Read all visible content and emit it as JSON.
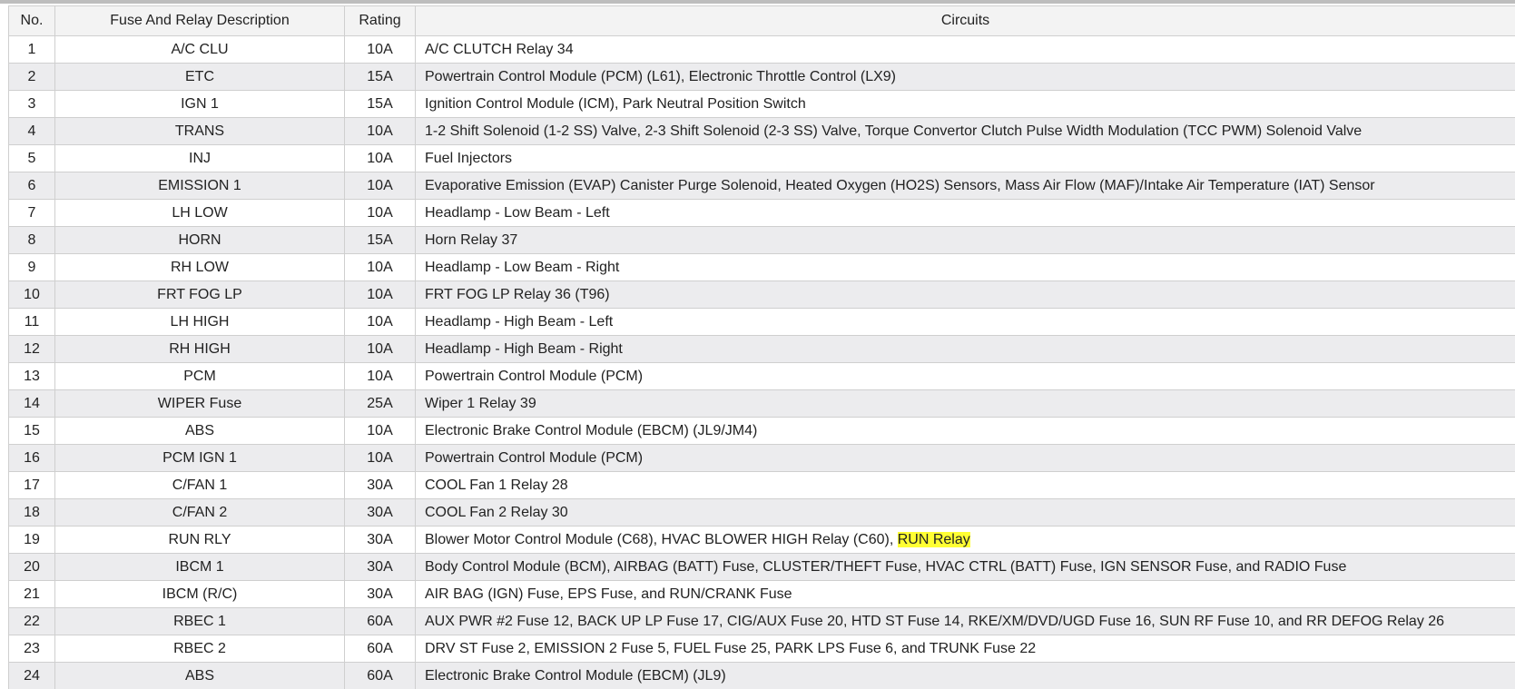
{
  "headers": [
    "No.",
    "Fuse And Relay Description",
    "Rating",
    "Circuits"
  ],
  "rows": [
    {
      "no": "1",
      "desc": "A/C CLU",
      "rating": "10A",
      "circuit": "A/C CLUTCH Relay 34"
    },
    {
      "no": "2",
      "desc": "ETC",
      "rating": "15A",
      "circuit": "Powertrain Control Module (PCM) (L61), Electronic Throttle Control (LX9)"
    },
    {
      "no": "3",
      "desc": "IGN 1",
      "rating": "15A",
      "circuit": "Ignition Control Module (ICM), Park Neutral Position Switch"
    },
    {
      "no": "4",
      "desc": "TRANS",
      "rating": "10A",
      "circuit": "1-2 Shift Solenoid (1-2 SS) Valve, 2-3 Shift Solenoid (2-3 SS) Valve, Torque Convertor Clutch Pulse Width Modulation (TCC PWM) Solenoid Valve"
    },
    {
      "no": "5",
      "desc": "INJ",
      "rating": "10A",
      "circuit": "Fuel Injectors"
    },
    {
      "no": "6",
      "desc": "EMISSION 1",
      "rating": "10A",
      "circuit": "Evaporative Emission (EVAP) Canister Purge Solenoid, Heated Oxygen (HO2S) Sensors, Mass Air Flow (MAF)/Intake Air Temperature (IAT) Sensor"
    },
    {
      "no": "7",
      "desc": "LH LOW",
      "rating": "10A",
      "circuit": "Headlamp - Low Beam - Left"
    },
    {
      "no": "8",
      "desc": "HORN",
      "rating": "15A",
      "circuit": "Horn Relay 37"
    },
    {
      "no": "9",
      "desc": "RH LOW",
      "rating": "10A",
      "circuit": "Headlamp - Low Beam - Right"
    },
    {
      "no": "10",
      "desc": "FRT FOG LP",
      "rating": "10A",
      "circuit": "FRT FOG LP Relay 36 (T96)"
    },
    {
      "no": "11",
      "desc": "LH HIGH",
      "rating": "10A",
      "circuit": "Headlamp - High Beam - Left"
    },
    {
      "no": "12",
      "desc": "RH HIGH",
      "rating": "10A",
      "circuit": "Headlamp - High Beam - Right"
    },
    {
      "no": "13",
      "desc": "PCM",
      "rating": "10A",
      "circuit": "Powertrain Control Module (PCM)"
    },
    {
      "no": "14",
      "desc": "WIPER Fuse",
      "rating": "25A",
      "circuit": "Wiper 1 Relay 39"
    },
    {
      "no": "15",
      "desc": "ABS",
      "rating": "10A",
      "circuit": "Electronic Brake Control Module (EBCM) (JL9/JM4)"
    },
    {
      "no": "16",
      "desc": "PCM IGN 1",
      "rating": "10A",
      "circuit": "Powertrain Control Module (PCM)"
    },
    {
      "no": "17",
      "desc": "C/FAN 1",
      "rating": "30A",
      "circuit": "COOL Fan 1 Relay 28"
    },
    {
      "no": "18",
      "desc": "C/FAN 2",
      "rating": "30A",
      "circuit": "COOL Fan 2 Relay 30"
    },
    {
      "no": "19",
      "desc": "RUN RLY",
      "rating": "30A",
      "circuit": "Blower Motor Control Module (C68), HVAC BLOWER HIGH Relay (C60), ",
      "highlight": "RUN Relay"
    },
    {
      "no": "20",
      "desc": "IBCM 1",
      "rating": "30A",
      "circuit": "Body Control Module (BCM), AIRBAG (BATT) Fuse, CLUSTER/THEFT Fuse, HVAC CTRL (BATT) Fuse, IGN SENSOR Fuse, and RADIO Fuse"
    },
    {
      "no": "21",
      "desc": "IBCM (R/C)",
      "rating": "30A",
      "circuit": "AIR BAG (IGN) Fuse, EPS Fuse, and RUN/CRANK Fuse"
    },
    {
      "no": "22",
      "desc": "RBEC 1",
      "rating": "60A",
      "circuit": "AUX PWR #2 Fuse 12, BACK UP LP Fuse 17, CIG/AUX Fuse 20, HTD ST Fuse 14, RKE/XM/DVD/UGD Fuse 16, SUN RF Fuse 10, and RR DEFOG Relay 26"
    },
    {
      "no": "23",
      "desc": "RBEC 2",
      "rating": "60A",
      "circuit": "DRV ST Fuse 2, EMISSION 2 Fuse 5, FUEL Fuse 25, PARK LPS Fuse 6, and TRUNK Fuse 22"
    },
    {
      "no": "24",
      "desc": "ABS",
      "rating": "60A",
      "circuit": "Electronic Brake Control Module (EBCM) (JL9)"
    }
  ]
}
